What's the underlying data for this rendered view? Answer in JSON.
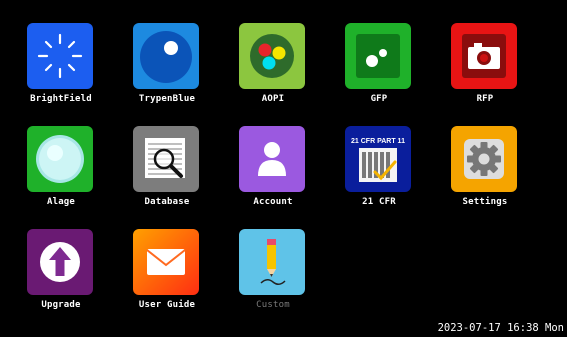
{
  "apps": [
    {
      "label": "BrightField"
    },
    {
      "label": "TrypenBlue"
    },
    {
      "label": "AOPI"
    },
    {
      "label": "GFP"
    },
    {
      "label": "RFP"
    },
    {
      "label": "Alage"
    },
    {
      "label": "Database"
    },
    {
      "label": "Account"
    },
    {
      "label": "21 CFR"
    },
    {
      "label": "Settings"
    },
    {
      "label": "Upgrade"
    },
    {
      "label": "User Guide"
    },
    {
      "label": "Custom"
    }
  ],
  "cfr_icon_text": "21 CFR PART 11",
  "clock": "2023-07-17 16:38 Mon"
}
